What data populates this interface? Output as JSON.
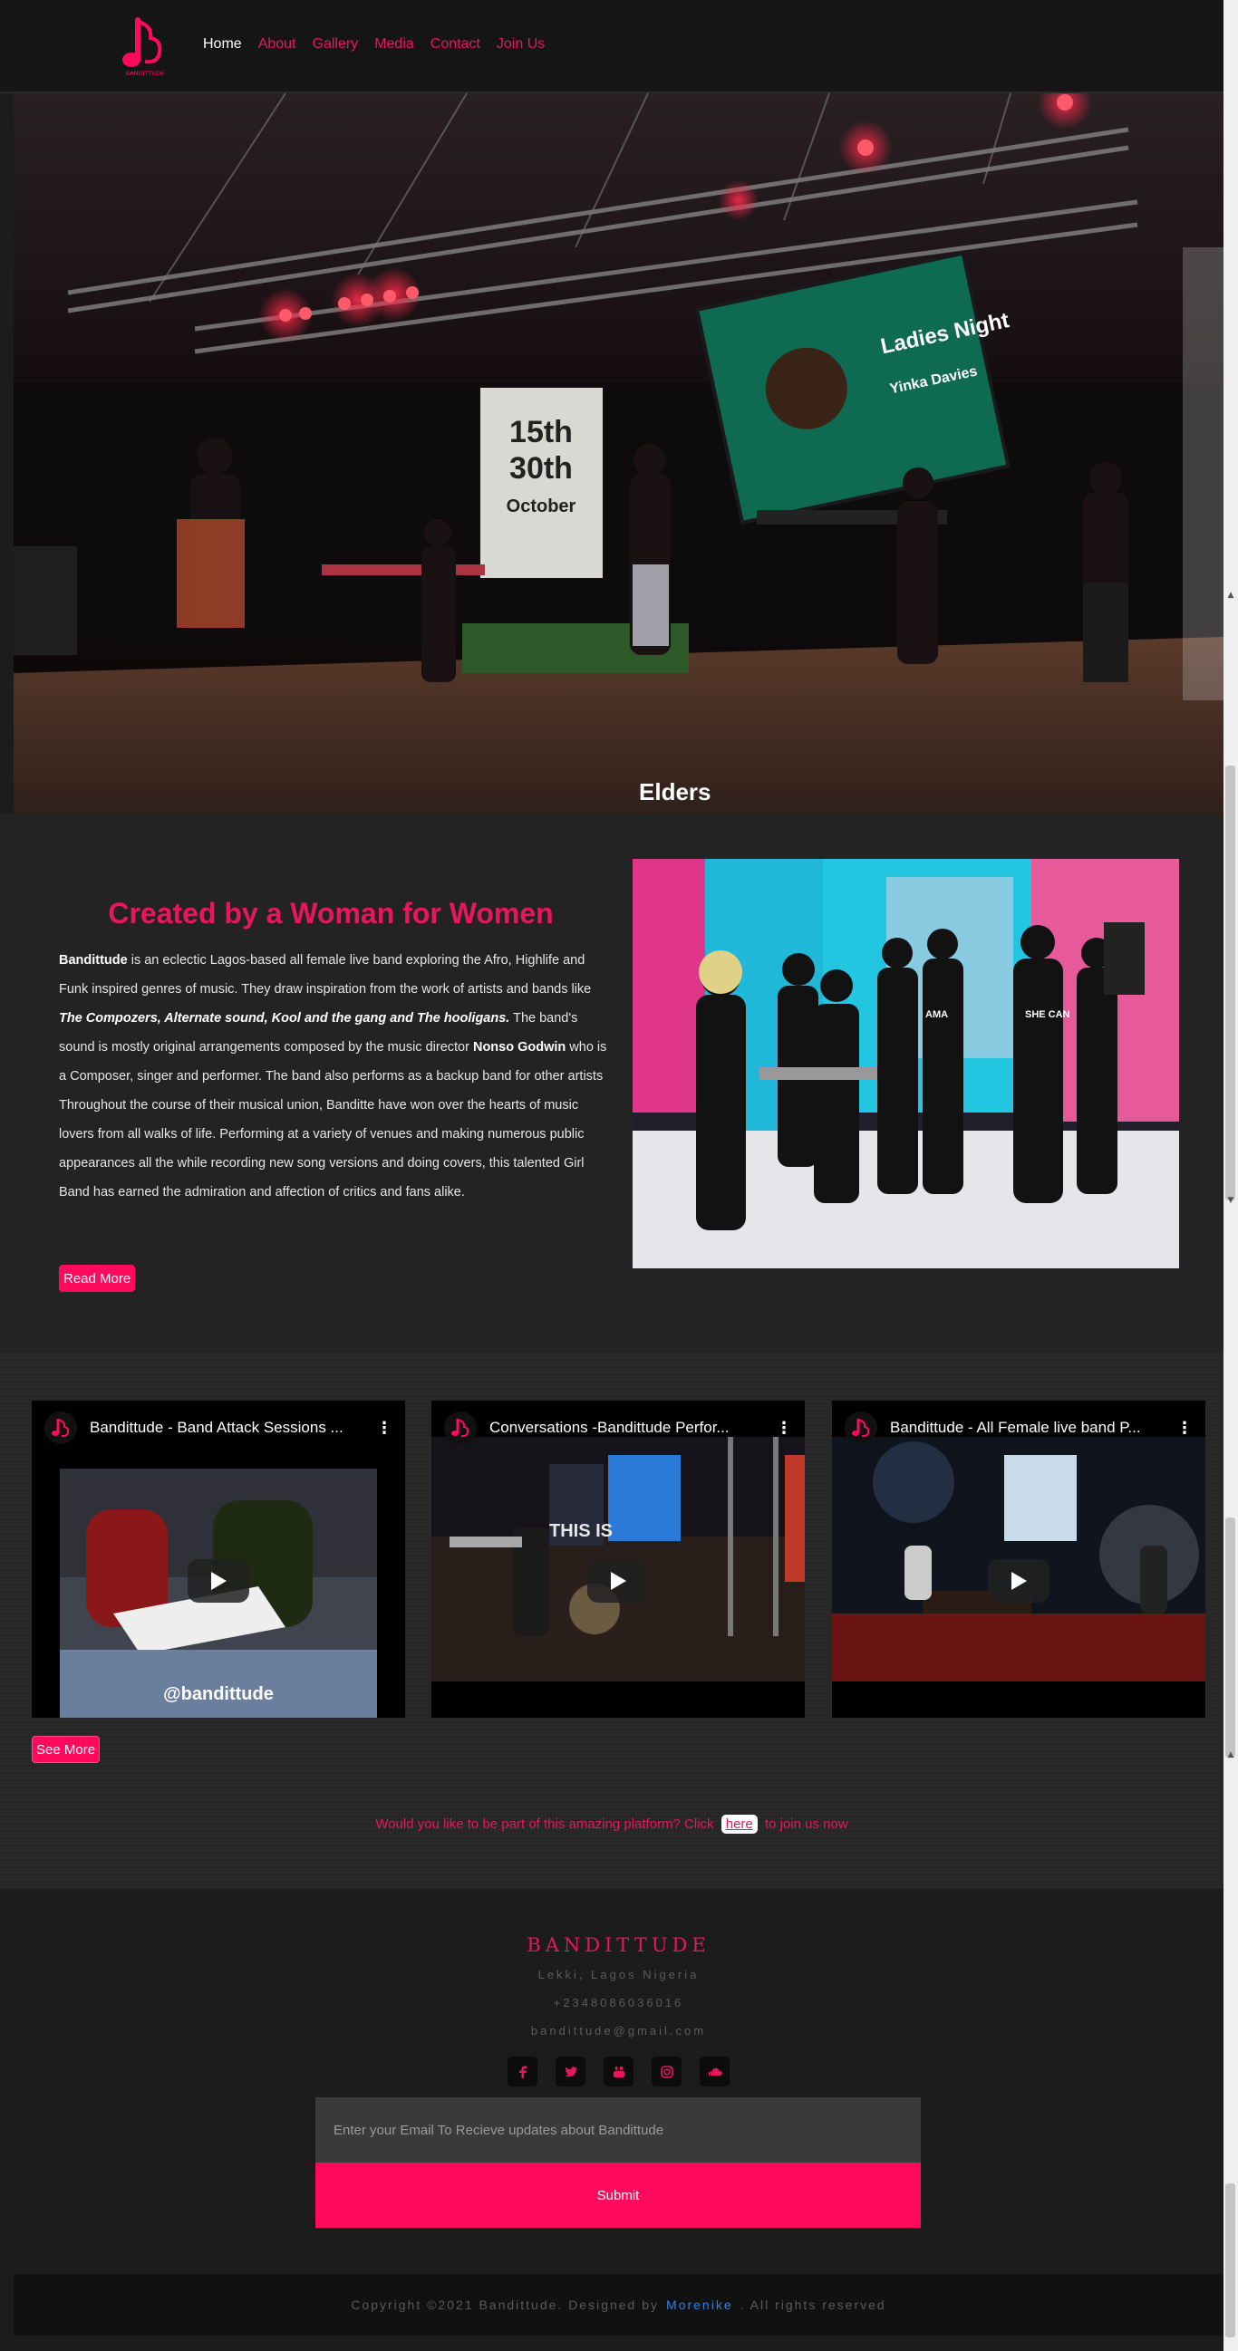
{
  "nav": {
    "logo_text": "BANDITTUDE",
    "links": [
      "Home",
      "About",
      "Gallery",
      "Media",
      "Contact",
      "Join Us"
    ],
    "active": "Home"
  },
  "hero": {
    "screen_lines": [
      "Ladies Night",
      "Yinka Davies"
    ],
    "banner_lines": [
      "15th",
      "30th",
      "October"
    ],
    "watermark": "Elders"
  },
  "about": {
    "title": "Created by a Woman for Women",
    "band_name": "Bandittude",
    "p1_a": " is an eclectic Lagos-based all female live band exploring the Afro, Highlife and Funk inspired genres of music. They draw inspiration from the work of artists and bands like ",
    "influences": "The Compozers, Alternate sound, Kool and the gang and The hooligans.",
    "p1_b": " The band's sound is mostly original arrangements composed by the music director ",
    "director": "Nonso Godwin",
    "p1_c": " who is a Composer, singer and performer. The band also performs as a backup band for other artists",
    "p2": "Throughout the course of their musical union, Banditte have won over the hearts of music lovers from all walks of life. Performing at a variety of venues and making numerous public appearances all the while recording new song versions and doing covers, this talented Girl Band has earned the admiration and affection of critics and fans alike.",
    "read_more": "Read More",
    "photo_shirts": [
      "SHE CAN",
      "AMA"
    ]
  },
  "videos": {
    "items": [
      {
        "title": "Bandittude - Band Attack Sessions ...",
        "overlay": "@bandittude"
      },
      {
        "title": "Conversations -Bandittude Perfor...",
        "overlay": "THIS IS"
      },
      {
        "title": "Bandittude - All Female live band P...",
        "overlay": ""
      }
    ],
    "see_more": "See More",
    "join_prompt_a": "Would you like to be part of this amazing platform? Click",
    "join_here": "here",
    "join_prompt_b": "to join us now"
  },
  "footer": {
    "brand": "BANDITTUDE",
    "address": "Lekki, Lagos Nigeria",
    "phone": "+2348086036016",
    "email": "bandittude@gmail.com",
    "socials": [
      "facebook-icon",
      "twitter-icon",
      "youtube-icon",
      "instagram-icon",
      "soundcloud-icon"
    ],
    "email_placeholder": "Enter your Email To Recieve updates about Bandittude",
    "submit": "Submit"
  },
  "copyright": {
    "text_a": "Copyright ©2021 Bandittude. Designed by",
    "designer": "Morenike",
    "text_b": ". All rights reserved"
  },
  "colors": {
    "accent": "#ff0a5c",
    "accent_text": "#e8175d",
    "link_blue": "#2f7fe8"
  }
}
